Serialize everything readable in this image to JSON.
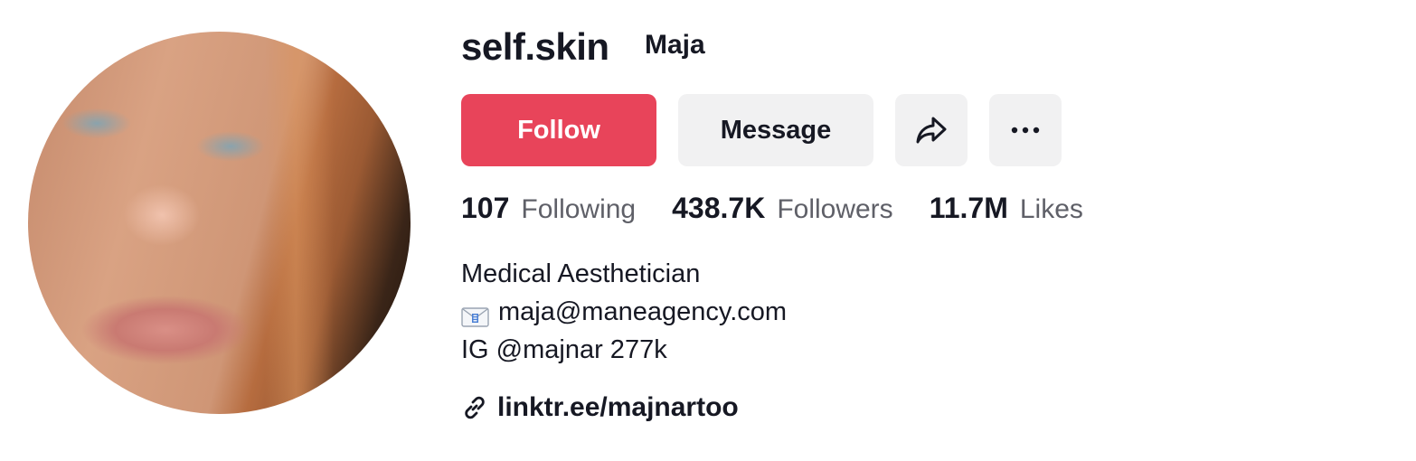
{
  "profile": {
    "username": "self.skin",
    "nickname": "Maja"
  },
  "actions": {
    "follow_label": "Follow",
    "message_label": "Message",
    "share_icon": "share-arrow-icon",
    "more_icon": "more-dots-icon"
  },
  "stats": {
    "following": {
      "value": "107",
      "label": "Following"
    },
    "followers": {
      "value": "438.7K",
      "label": "Followers"
    },
    "likes": {
      "value": "11.7M",
      "label": "Likes"
    }
  },
  "bio": {
    "line1": "Medical Aesthetician",
    "email_icon": "envelope-icon",
    "line2": "maja@maneagency.com",
    "line3": "IG @majnar 277k"
  },
  "link": {
    "icon": "link-icon",
    "text": "linktr.ee/majnartoo"
  },
  "colors": {
    "follow_bg": "#e8445a",
    "secondary_bg": "#f1f1f2",
    "text": "#161823",
    "muted_text": "#5f6068"
  }
}
